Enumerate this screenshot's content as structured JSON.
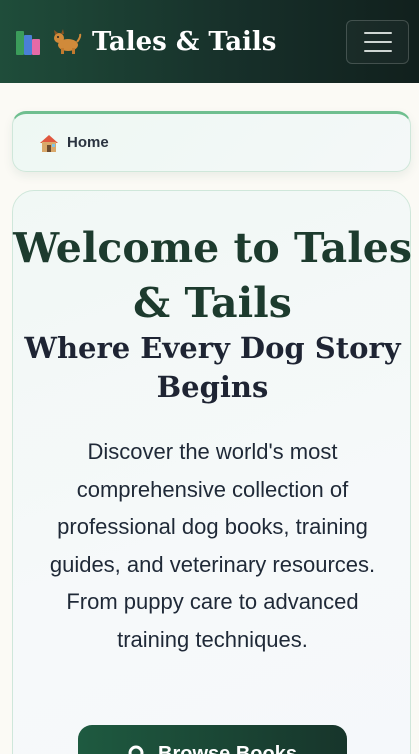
{
  "navbar": {
    "brand_title": "Tales & Tails",
    "books_icon": "books-icon",
    "dog_icon": "dog-icon",
    "menu_icon": "hamburger-menu-icon",
    "background": "#1f4d3a"
  },
  "breadcrumb": {
    "home_label": "Home",
    "home_icon": "house-icon"
  },
  "hero": {
    "title": "Welcome to Tales & Tails",
    "subtitle": "Where Every Dog Story Begins",
    "description": "Discover the world's most comprehensive collection of professional dog books, training guides, and veterinary resources. From puppy care to advanced training techniques.",
    "cta_label": "Browse Books",
    "cta_icon": "search-icon"
  },
  "colors": {
    "accent_green": "#1d3b2e",
    "border_green": "#6fbf8f",
    "page_background": "#fbfaf5"
  }
}
